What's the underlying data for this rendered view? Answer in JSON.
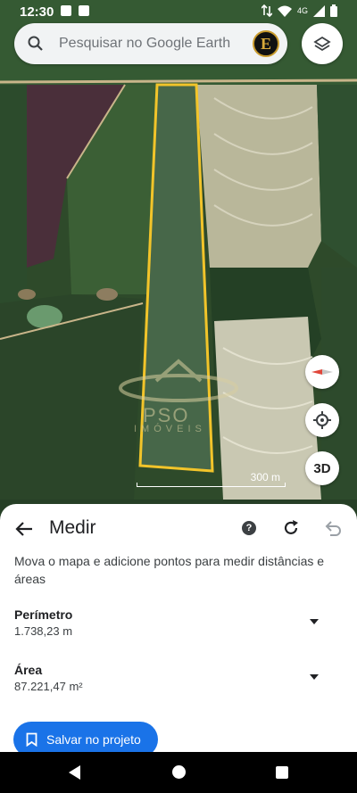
{
  "status_bar": {
    "time": "12:30",
    "network": "4G"
  },
  "search": {
    "placeholder": "Pesquisar no Google Earth",
    "avatar_letter": "E"
  },
  "map": {
    "scale_label": "300 m",
    "view_3d_label": "3D",
    "watermark_line1": "PSO",
    "watermark_line2": "IMÓVEIS",
    "outline_color": "#f2c42a"
  },
  "measure_panel": {
    "title": "Medir",
    "description": "Mova o mapa e adicione pontos para medir distâncias e áreas",
    "perimeter_label": "Perímetro",
    "perimeter_value": "1.738,23 m",
    "area_label": "Área",
    "area_value": "87.221,47 m²",
    "save_label": "Salvar no projeto",
    "accent_color": "#1a73e8"
  }
}
